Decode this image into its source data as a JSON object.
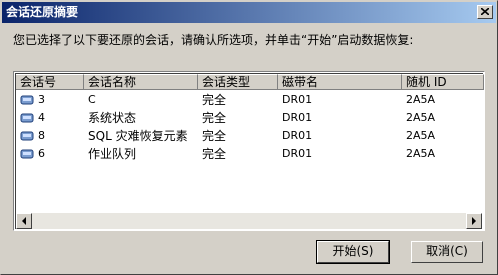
{
  "window": {
    "title": "会话还原摘要"
  },
  "instruction": "您已选择了以下要还原的会话，请确认所选项，并单击“开始”启动数据恢复:",
  "table": {
    "columns": [
      "会话号",
      "会话名称",
      "会话类型",
      "磁带名",
      "随机 ID"
    ],
    "rows": [
      [
        "3",
        "C",
        "完全",
        "DR01",
        "2A5A"
      ],
      [
        "4",
        "系统状态",
        "完全",
        "DR01",
        "2A5A"
      ],
      [
        "8",
        "SQL 灾难恢复元素",
        "完全",
        "DR01",
        "2A5A"
      ],
      [
        "6",
        "作业队列",
        "完全",
        "DR01",
        "2A5A"
      ]
    ]
  },
  "buttons": {
    "start": "开始(S)",
    "cancel": "取消(C)"
  },
  "icons": {
    "close": "close-icon",
    "row": "session-icon",
    "scroll_left": "arrow-left-icon",
    "scroll_right": "arrow-right-icon"
  }
}
